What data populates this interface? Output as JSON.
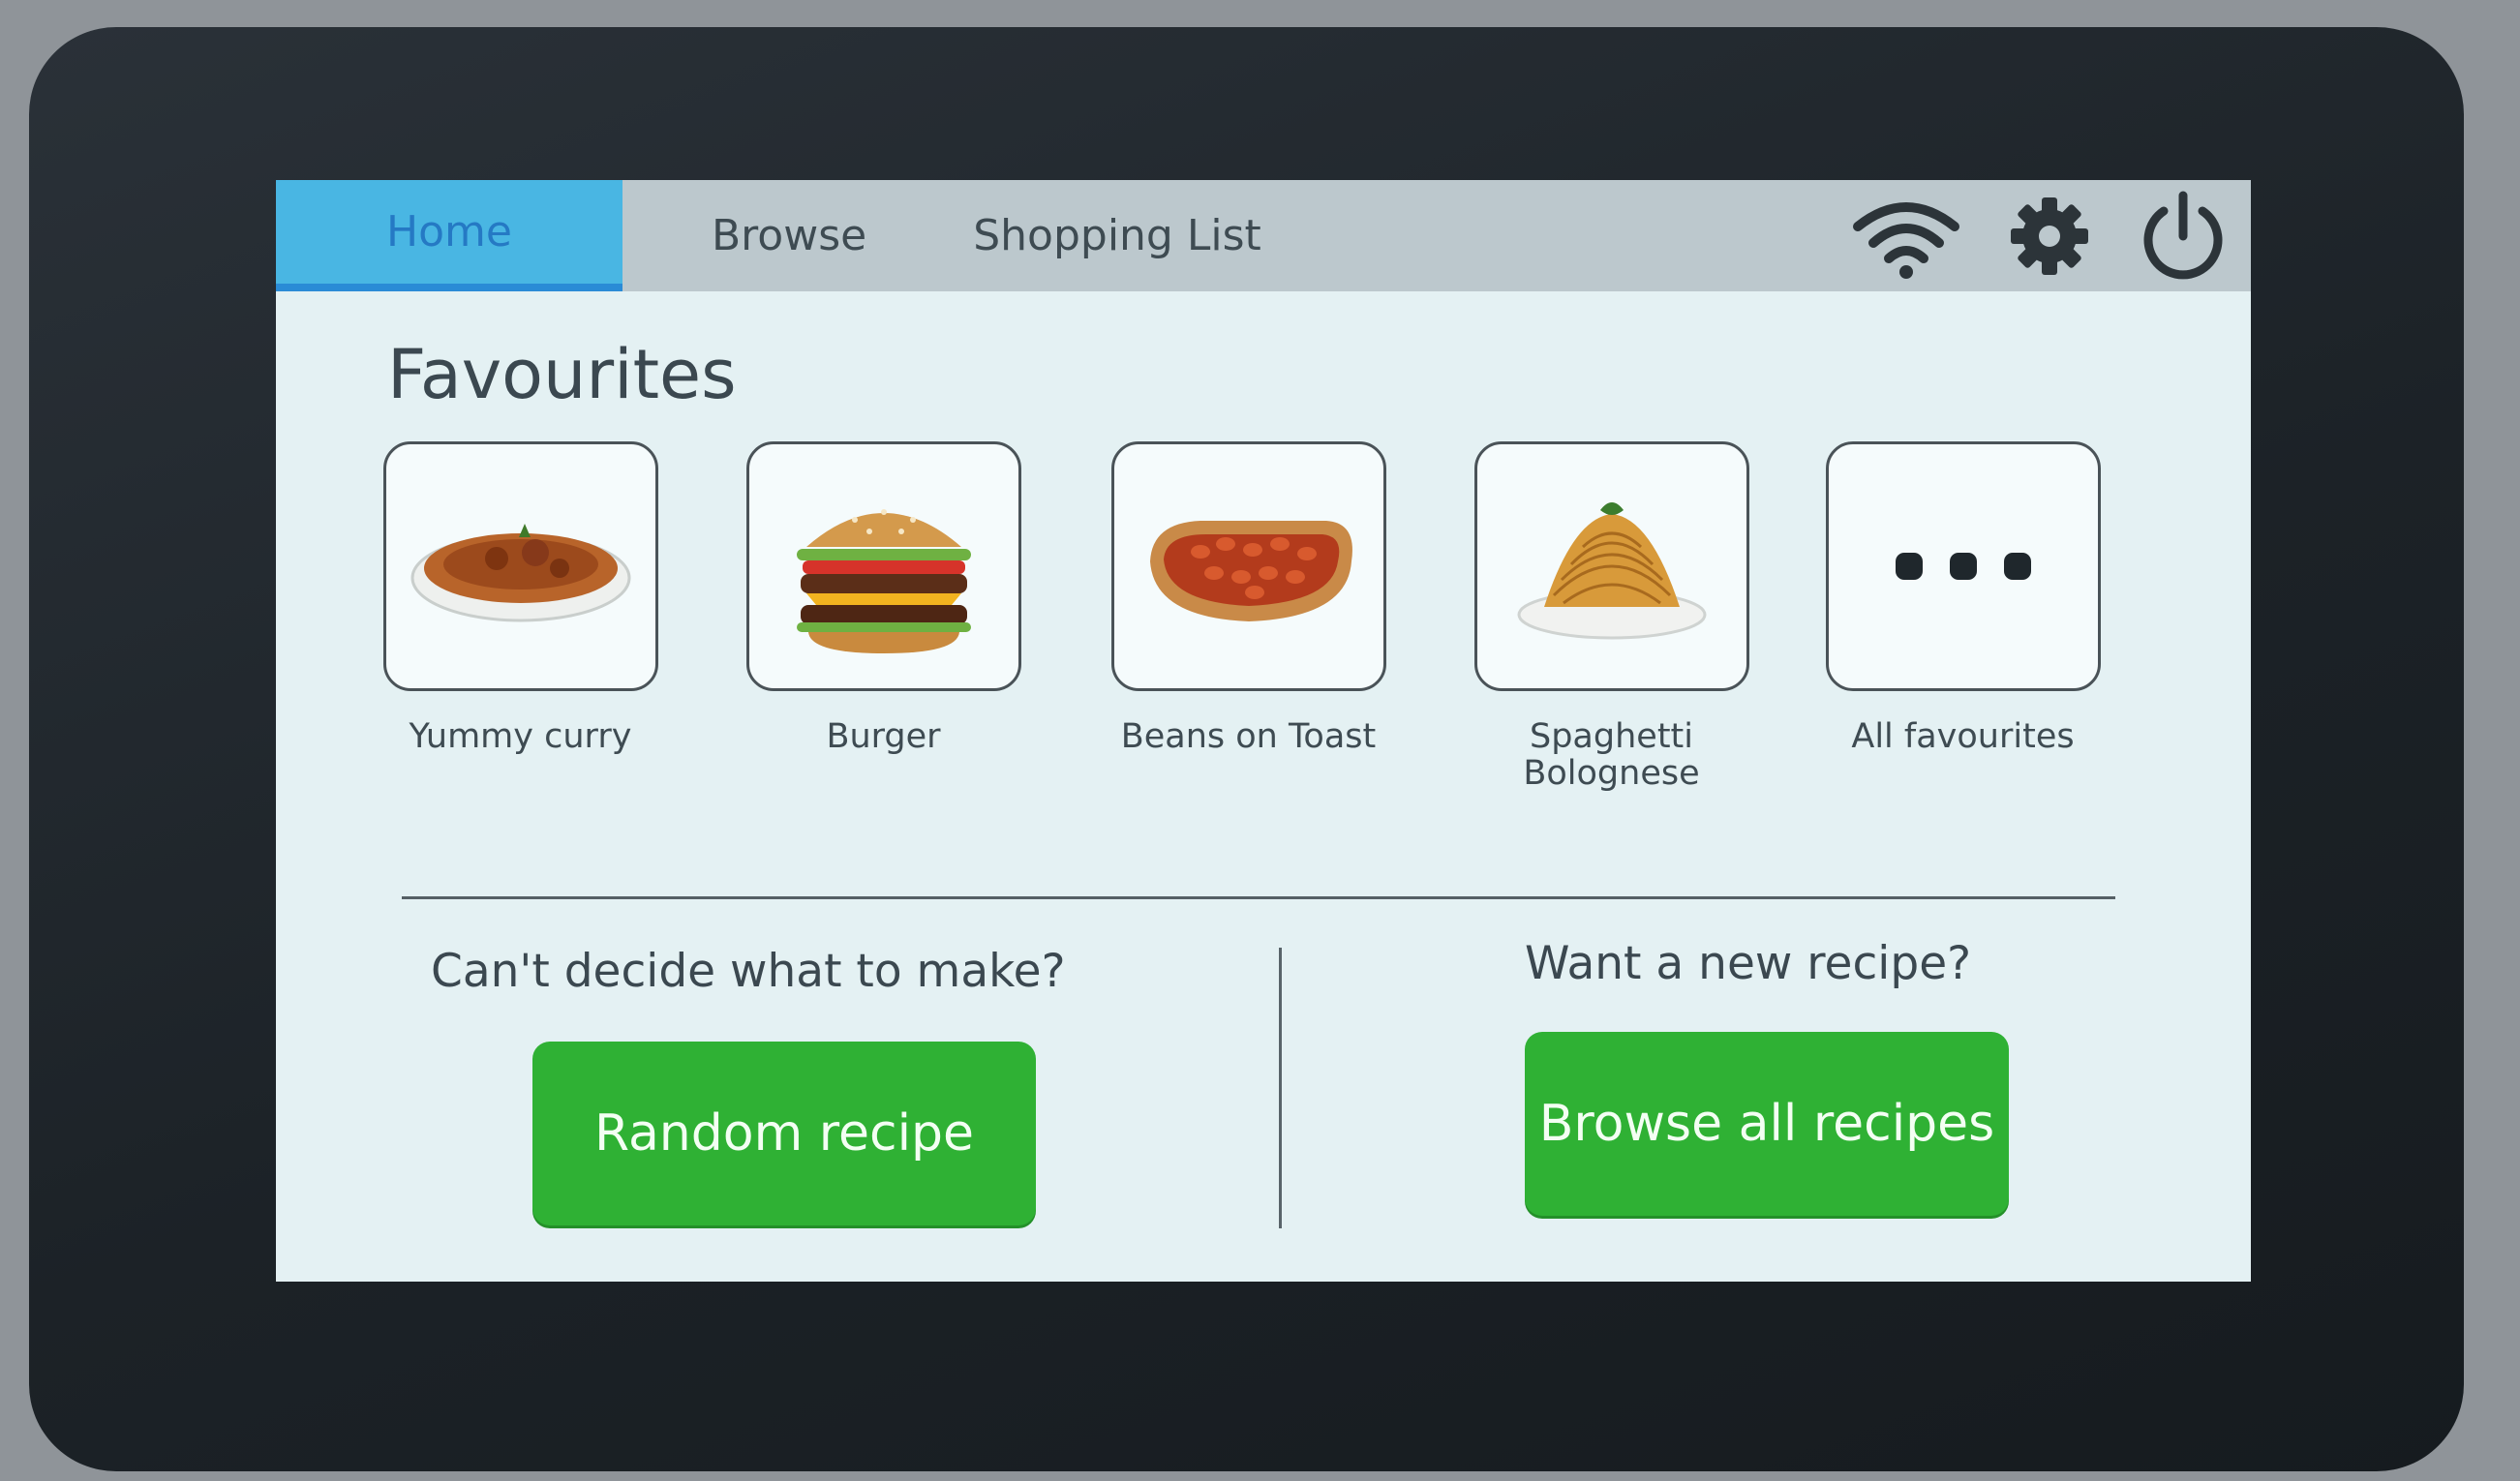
{
  "nav": {
    "tabs": [
      {
        "label": "Home",
        "active": true
      },
      {
        "label": "Browse",
        "active": false
      },
      {
        "label": "Shopping List",
        "active": false
      }
    ],
    "icons": [
      "wifi-icon",
      "gear-icon",
      "power-icon"
    ]
  },
  "favourites": {
    "heading": "Favourites",
    "items": [
      {
        "label": "Yummy curry",
        "image": "curry-image"
      },
      {
        "label": "Burger",
        "image": "burger-image"
      },
      {
        "label": "Beans on Toast",
        "image": "beans-on-toast-image"
      },
      {
        "label": "Spaghetti Bolognese",
        "label_line1": "Spaghetti",
        "label_line2": "Bolognese",
        "image": "spaghetti-image"
      },
      {
        "label": "All favourites",
        "image": "more-dots-icon"
      }
    ]
  },
  "random": {
    "prompt": "Can't decide what to make?",
    "button_label": "Random recipe"
  },
  "browse_all": {
    "prompt": "Want a new recipe?",
    "button_label": "Browse all recipes"
  },
  "colors": {
    "active_tab": "#49b6e3",
    "active_tab_text": "#2579c4",
    "button_green": "#2fb134",
    "screen_bg": "#e4f1f3",
    "topbar_bg": "#bcc8cd"
  }
}
